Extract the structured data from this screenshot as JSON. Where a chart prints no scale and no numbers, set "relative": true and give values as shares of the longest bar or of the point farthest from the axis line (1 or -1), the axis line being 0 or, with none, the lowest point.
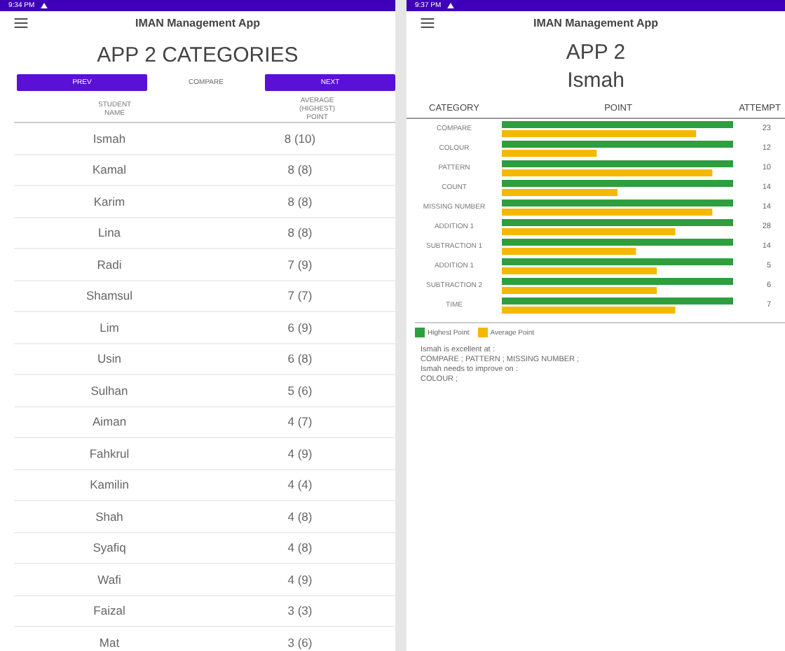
{
  "left": {
    "status_bar": {
      "time": "9:34 PM"
    },
    "app_title": "IMAN Management App",
    "heading": "APP 2 CATEGORIES",
    "buttons": [
      {
        "label": "PREV",
        "kind": "filled"
      },
      {
        "label": "COMPARE",
        "kind": "text"
      },
      {
        "label": "NEXT",
        "kind": "filled"
      }
    ],
    "table": {
      "columns": [
        "STUDENT NAME",
        "AVERAGE (HIGHEST) POINT"
      ],
      "rows": [
        [
          "Ismah",
          "8 (10)"
        ],
        [
          "Kamal",
          "8 (8)"
        ],
        [
          "Karim",
          "8 (8)"
        ],
        [
          "Lina",
          "8 (8)"
        ],
        [
          "Radi",
          "7 (9)"
        ],
        [
          "Shamsul",
          "7 (7)"
        ],
        [
          "Lim",
          "6 (9)"
        ],
        [
          "Usin",
          "6 (8)"
        ],
        [
          "Sulhan",
          "5 (6)"
        ],
        [
          "Aiman",
          "4 (7)"
        ],
        [
          "Fahkrul",
          "4 (9)"
        ],
        [
          "Kamilin",
          "4 (4)"
        ],
        [
          "Shah",
          "4 (8)"
        ],
        [
          "Syafiq",
          "4 (8)"
        ],
        [
          "Wafi",
          "4 (9)"
        ],
        [
          "Faizal",
          "3 (3)"
        ],
        [
          "Mat",
          "3 (6)"
        ]
      ]
    }
  },
  "right": {
    "status_bar": {
      "time": "9:37 PM"
    },
    "app_title": "IMAN Management App",
    "heading": "APP 2",
    "student": "Ismah",
    "table": {
      "columns": [
        "CATEGORY",
        "POINT",
        "ATTEMPT"
      ],
      "rows": [
        {
          "category": "COMPARE",
          "attempt": "23"
        },
        {
          "category": "COLOUR",
          "attempt": "12"
        },
        {
          "category": "PATTERN",
          "attempt": "10"
        },
        {
          "category": "COUNT",
          "attempt": "14"
        },
        {
          "category": "MISSING NUMBER",
          "attempt": "14"
        },
        {
          "category": "ADDITION 1",
          "attempt": "28"
        },
        {
          "category": "SUBTRACTION 1",
          "attempt": "14"
        },
        {
          "category": "ADDITION 1",
          "attempt": "5"
        },
        {
          "category": "SUBTRACTION 2",
          "attempt": "6"
        },
        {
          "category": "TIME",
          "attempt": "7"
        }
      ],
      "chart_data": {
        "type": "bar",
        "orientation": "horizontal",
        "relative": true,
        "series": [
          {
            "name": "Highest Point",
            "color": "#2e9e3f",
            "values": [
              1,
              1,
              1,
              1,
              1,
              1,
              1,
              1,
              1,
              1
            ]
          },
          {
            "name": "Average Point",
            "color": "#f5b800",
            "values": [
              0.84,
              0.41,
              0.91,
              0.5,
              0.91,
              0.75,
              0.58,
              0.67,
              0.67,
              0.75
            ]
          }
        ]
      }
    },
    "summary": [
      "Ismah is excellent at :",
      "COMPARE ; PATTERN ; MISSING NUMBER ;",
      "Ismah needs to improve on :",
      "COLOUR ;"
    ]
  }
}
